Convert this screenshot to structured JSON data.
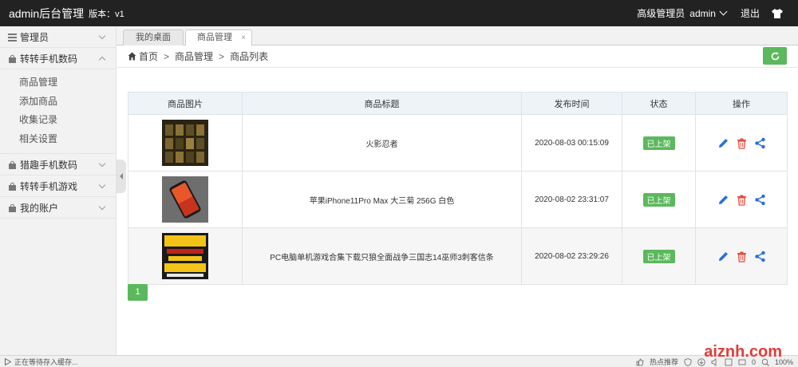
{
  "header": {
    "brand": "admin后台管理",
    "version": "版本：v1",
    "role": "高级管理员",
    "username": "admin",
    "logout": "退出"
  },
  "sidebar": {
    "items": [
      {
        "label": "管理员"
      },
      {
        "label": "转转手机数码",
        "open": true,
        "children": [
          "商品管理",
          "添加商品",
          "收集记录",
          "相关设置"
        ]
      },
      {
        "label": "猎趣手机数码"
      },
      {
        "label": "转转手机游戏"
      },
      {
        "label": "我的账户"
      }
    ]
  },
  "tabs": [
    {
      "label": "我的桌面"
    },
    {
      "label": "商品管理",
      "close": "×"
    }
  ],
  "breadcrumb": [
    "首页",
    "商品管理",
    "商品列表"
  ],
  "breadcrumb_sep": ">",
  "table": {
    "headers": [
      "商品图片",
      "商品标题",
      "发布时间",
      "状态",
      "操作"
    ],
    "rows": [
      {
        "title": "火影忍者",
        "time": "2020-08-03 00:15:09",
        "status": "已上架"
      },
      {
        "title": "苹果iPhone11Pro Max 大三菊 256G 白色",
        "time": "2020-08-02 23:31:07",
        "status": "已上架"
      },
      {
        "title": "PC电脑单机游戏合集下载只狼全面战争三国志14巫师3刺客信条",
        "time": "2020-08-02 23:29:26",
        "status": "已上架"
      }
    ]
  },
  "pagination": {
    "current": "1"
  },
  "statusbar": {
    "left": "正在等待存入缓存...",
    "hot": "热点推荐",
    "counter": "0",
    "zoom": "100%"
  },
  "watermark": "aiznh.com",
  "colors": {
    "accent": "#5cb85c",
    "header": "#222222",
    "delete": "#e74c3c",
    "edit": "#2a6fdb"
  }
}
